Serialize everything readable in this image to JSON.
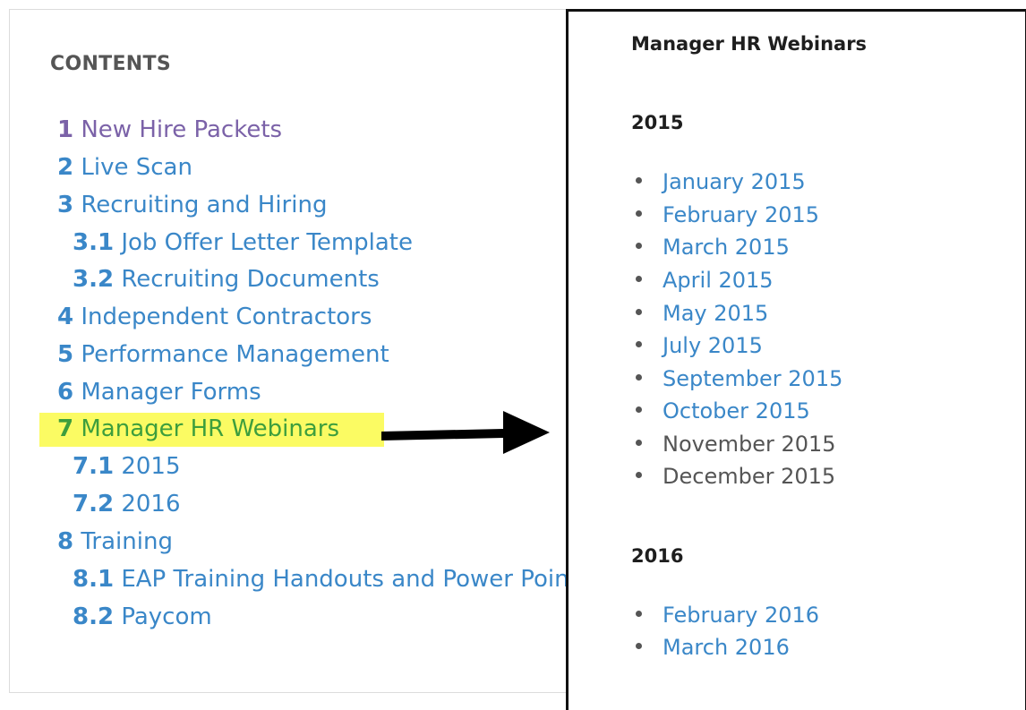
{
  "toc": {
    "title": "CONTENTS",
    "items": [
      {
        "num": "1",
        "label": "New Hire Packets"
      },
      {
        "num": "2",
        "label": "Live Scan"
      },
      {
        "num": "3",
        "label": "Recruiting and Hiring"
      },
      {
        "num": "3.1",
        "label": "Job Offer Letter Template"
      },
      {
        "num": "3.2",
        "label": "Recruiting Documents"
      },
      {
        "num": "4",
        "label": "Independent Contractors"
      },
      {
        "num": "5",
        "label": "Performance Management"
      },
      {
        "num": "6",
        "label": "Manager Forms"
      },
      {
        "num": "7",
        "label": "Manager HR Webinars"
      },
      {
        "num": "7.1",
        "label": "2015"
      },
      {
        "num": "7.2",
        "label": "2016"
      },
      {
        "num": "8",
        "label": "Training"
      },
      {
        "num": "8.1",
        "label": "EAP Training Handouts and Power Points"
      },
      {
        "num": "8.2",
        "label": "Paycom"
      }
    ]
  },
  "panel": {
    "title": "Manager HR Webinars",
    "years": [
      {
        "heading": "2015",
        "months": [
          "January 2015",
          "February 2015",
          "March 2015",
          "April 2015",
          "May 2015",
          "July 2015",
          "September 2015",
          "October 2015",
          "November 2015",
          "December 2015"
        ]
      },
      {
        "heading": "2016",
        "months": [
          "February 2016",
          "March 2016"
        ]
      }
    ]
  },
  "colors": {
    "link": "#3a87c8",
    "visited_link": "#7b62a8",
    "highlight_background": "#fbfb63",
    "highlight_text": "#3d9e3d",
    "heading": "#555555",
    "panel_border": "#111111"
  },
  "icons": {
    "pointer": "right-arrow-icon"
  }
}
